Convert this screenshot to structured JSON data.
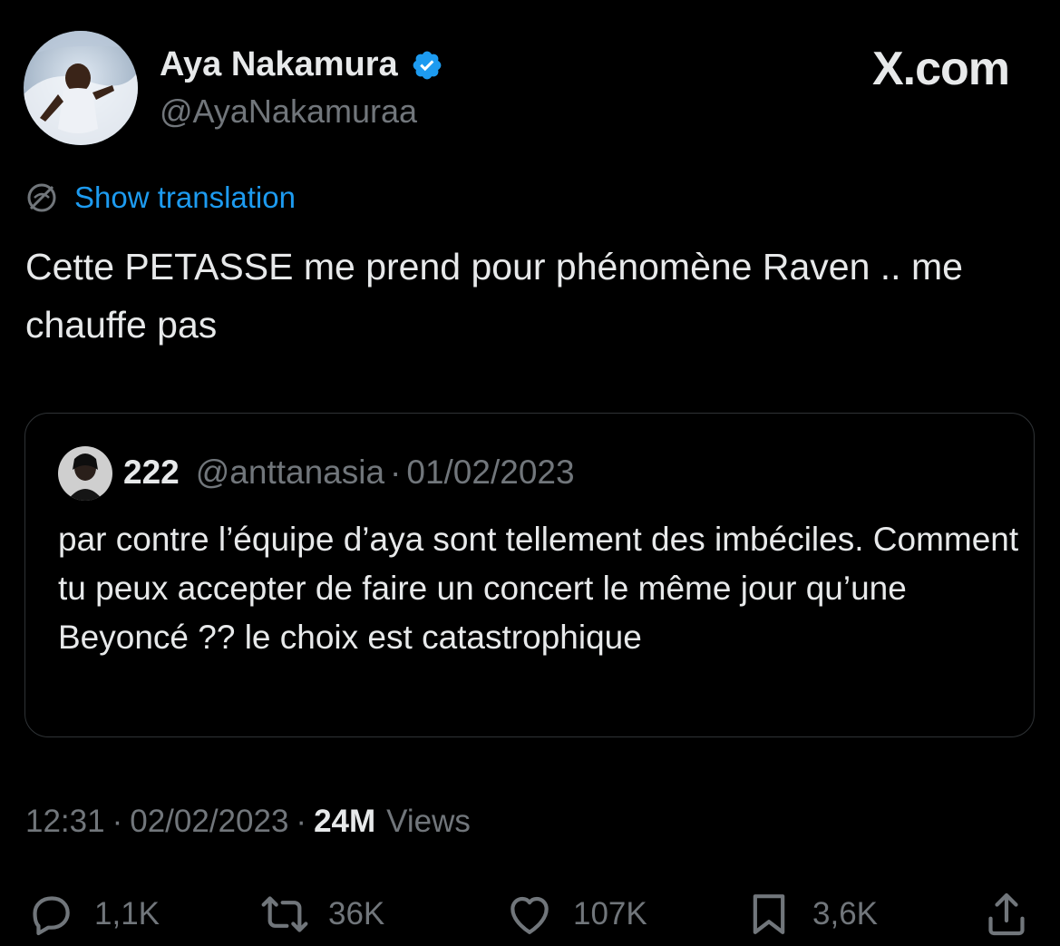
{
  "tweet": {
    "author": {
      "name": "Aya Nakamura",
      "handle": "@AyaNakamuraa",
      "verified": true
    },
    "brand": "X.com",
    "translate_label": "Show translation",
    "text": "Cette PETASSE me prend pour phénomène Raven .. me chauffe pas",
    "quote": {
      "name": "222",
      "handle": "@anttanasia",
      "separator": "·",
      "date": "01/02/2023",
      "text": "par contre l’équipe d’aya sont tellement des imbéciles. Comment tu peux accepter de faire un concert le même jour qu’une Beyoncé ?? le choix est catastrophique"
    },
    "meta": {
      "time": "12:31",
      "separator": "·",
      "date": "02/02/2023",
      "views_count": "24M",
      "views_label": "Views"
    },
    "actions": {
      "replies": "1,1K",
      "reposts": "36K",
      "likes": "107K",
      "bookmarks": "3,6K"
    }
  },
  "colors": {
    "background": "#000000",
    "text_primary": "#e7e9ea",
    "text_secondary": "#71767b",
    "link": "#1d9bf0",
    "verified_badge": "#1d9bf0",
    "border": "#2f3336"
  },
  "icons": [
    "verified-badge-icon",
    "translate-globe-icon",
    "reply-icon",
    "repost-icon",
    "like-icon",
    "bookmark-icon",
    "share-icon"
  ]
}
